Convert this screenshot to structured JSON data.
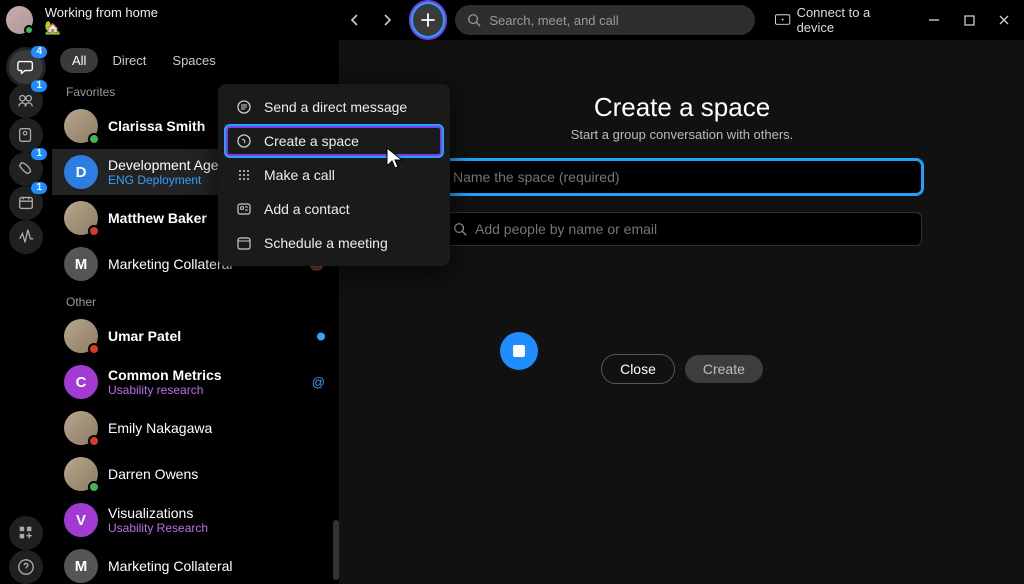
{
  "topbar": {
    "status": "Working from home 🏡",
    "search_placeholder": "Search, meet, and call",
    "device_label": "Connect to a device"
  },
  "rail": {
    "items": [
      {
        "icon": "chat",
        "badge": "4",
        "active": true
      },
      {
        "icon": "teams",
        "badge": "1"
      },
      {
        "icon": "contacts"
      },
      {
        "icon": "calls",
        "badge": "1"
      },
      {
        "icon": "calendar",
        "badge": "1"
      },
      {
        "icon": "activity"
      }
    ],
    "bottom": [
      {
        "icon": "apps"
      },
      {
        "icon": "help"
      }
    ]
  },
  "tabs": {
    "all": "All",
    "direct": "Direct",
    "spaces": "Spaces"
  },
  "sections": {
    "favorites": "Favorites",
    "other": "Other"
  },
  "conversations": {
    "favorites": [
      {
        "name": "Clarissa Smith",
        "bold": true,
        "avatar": "photo",
        "presence": "#44b556"
      },
      {
        "name": "Development Agenc",
        "sub": "ENG Deployment",
        "avatar": "blue",
        "letter": "D",
        "selected": true
      },
      {
        "name": "Matthew Baker",
        "bold": true,
        "avatar": "photo",
        "presence": "#d33b2b"
      },
      {
        "name": "Marketing Collateral",
        "avatar": "grey",
        "letter": "M",
        "muted": true
      }
    ],
    "other": [
      {
        "name": "Umar Patel",
        "bold": true,
        "avatar": "photo",
        "presence": "#d33b2b",
        "unread": true
      },
      {
        "name": "Common Metrics",
        "bold": true,
        "sub": "Usability research",
        "subColor": "purple",
        "avatar": "purple",
        "letter": "C",
        "mention": true
      },
      {
        "name": "Emily Nakagawa",
        "avatar": "photo",
        "presence": "#d33b2b"
      },
      {
        "name": "Darren Owens",
        "avatar": "photo",
        "presence": "#44b556"
      },
      {
        "name": "Visualizations",
        "sub": "Usability Research",
        "subColor": "purple",
        "avatar": "purple",
        "letter": "V"
      },
      {
        "name": "Marketing Collateral",
        "avatar": "grey",
        "letter": "M"
      }
    ]
  },
  "plus_menu": [
    {
      "icon": "chat",
      "label": "Send a direct message"
    },
    {
      "icon": "space",
      "label": "Create a space",
      "selected": true
    },
    {
      "icon": "dial",
      "label": "Make a call"
    },
    {
      "icon": "contact",
      "label": "Add a contact"
    },
    {
      "icon": "calendar",
      "label": "Schedule a meeting"
    }
  ],
  "main": {
    "title": "Create a space",
    "subtitle": "Start a group conversation with others.",
    "name_placeholder": "Name the space (required)",
    "people_placeholder": "Add people by name or email",
    "close": "Close",
    "create": "Create"
  }
}
